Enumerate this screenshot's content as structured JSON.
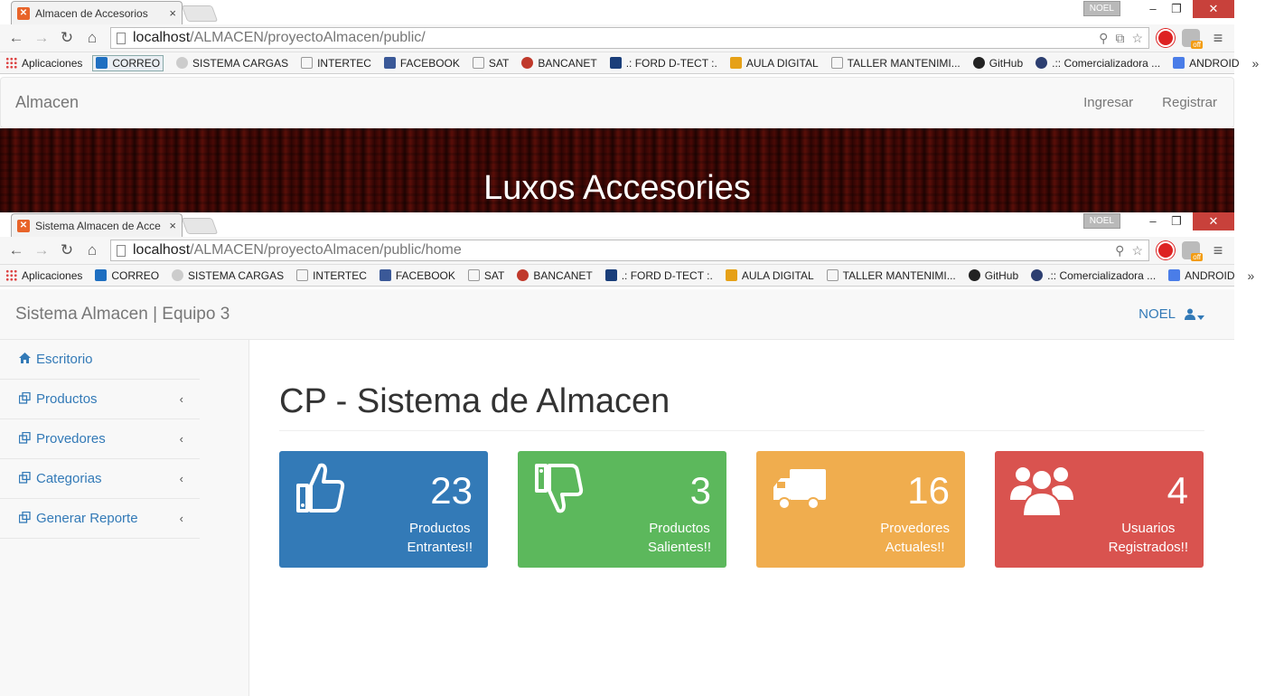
{
  "window1": {
    "tab_title": "Almacen de Accesorios",
    "user_badge": "NOEL",
    "url_host": "localhost",
    "url_path": "/ALMACEN/proyectoAlmacen/public/",
    "navbar": {
      "brand": "Almacen",
      "login": "Ingresar",
      "register": "Registrar"
    },
    "hero_title": "Luxos Accesories"
  },
  "window2": {
    "tab_title": "Sistema Almacen de Acce",
    "user_badge": "NOEL",
    "url_host": "localhost",
    "url_path": "/ALMACEN/proyectoAlmacen/public/home",
    "navbar": {
      "brand": "Sistema Almacen | Equipo 3",
      "user": "NOEL"
    },
    "sidebar": [
      {
        "label": "Escritorio",
        "icon": "home-icon"
      },
      {
        "label": "Productos",
        "icon": "clone-icon"
      },
      {
        "label": "Provedores",
        "icon": "clone-icon"
      },
      {
        "label": "Categorias",
        "icon": "clone-icon"
      },
      {
        "label": "Generar Reporte",
        "icon": "clone-icon"
      }
    ],
    "page_title": "CP - Sistema de Almacen",
    "cards": [
      {
        "count": "23",
        "line1": "Productos",
        "line2": "Entrantes!!",
        "icon": "thumbs-up-icon",
        "color": "#337ab7"
      },
      {
        "count": "3",
        "line1": "Productos",
        "line2": "Salientes!!",
        "icon": "thumbs-down-icon",
        "color": "#5cb85c"
      },
      {
        "count": "16",
        "line1": "Provedores",
        "line2": "Actuales!!",
        "icon": "truck-icon",
        "color": "#f0ad4e"
      },
      {
        "count": "4",
        "line1": "Usuarios",
        "line2": "Registrados!!",
        "icon": "users-icon",
        "color": "#d9534f"
      }
    ]
  },
  "bookmarks": {
    "apps": "Aplicaciones",
    "items": [
      "CORREO",
      "SISTEMA CARGAS",
      "INTERTEC",
      "FACEBOOK",
      "SAT",
      "BANCANET",
      ".: FORD D-TECT :.",
      "AULA DIGITAL",
      "TALLER MANTENIMI...",
      "GitHub",
      ".:: Comercializadora ...",
      "ANDROID"
    ],
    "more": "»"
  }
}
